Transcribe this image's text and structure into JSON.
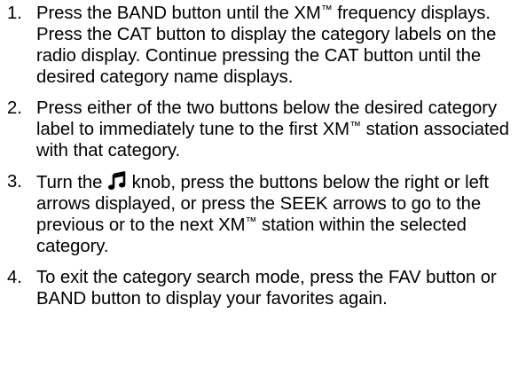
{
  "steps": [
    {
      "number": "1.",
      "parts": [
        "Press the BAND button until the XM",
        "™",
        " frequency displays. Press the CAT button to display the category labels on the radio display. Continue pressing the CAT button until the desired category name displays."
      ]
    },
    {
      "number": "2.",
      "parts": [
        "Press either of the two buttons below the desired category label to immediately tune to the first XM",
        "™",
        " station associated with that category."
      ]
    },
    {
      "number": "3.",
      "parts": [
        "Turn the",
        "knob, press the buttons below the right or left arrows displayed, or press the SEEK arrows to go to the previous or to the next XM",
        "™",
        " station within the selected category."
      ]
    },
    {
      "number": "4.",
      "parts": [
        "To exit the category search mode, press the FAV button or BAND button to display your favorites again."
      ]
    }
  ],
  "icons": {
    "music_knob": "music-note-icon"
  }
}
